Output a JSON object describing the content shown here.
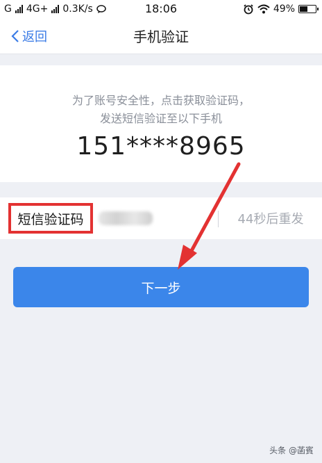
{
  "status_bar": {
    "carrier_left": "G",
    "network": "4G+",
    "speed": "0.3K/s",
    "time": "18:06",
    "battery_percent": "49%",
    "battery_level": 0.49
  },
  "nav": {
    "back_label": "返回",
    "title": "手机验证"
  },
  "info": {
    "line1": "为了账号安全性，点击获取验证码，",
    "line2": "发送短信验证至以下手机",
    "phone": "151****8965"
  },
  "code_row": {
    "label": "短信验证码",
    "input_value": "",
    "resend": "44秒后重发"
  },
  "next_button": {
    "label": "下一步"
  },
  "annotation": {
    "arrow_color": "#e33232",
    "label_box_color": "#e33232"
  },
  "watermark": {
    "text": "头条 @菡賓"
  },
  "colors": {
    "accent": "#3b86ea",
    "link": "#3a7be6",
    "background": "#eef0f5"
  },
  "icons": {
    "back": "chevron-left-icon",
    "alarm": "alarm-icon",
    "wifi": "wifi-icon",
    "battery": "battery-icon",
    "message": "chat-bubble-icon"
  }
}
